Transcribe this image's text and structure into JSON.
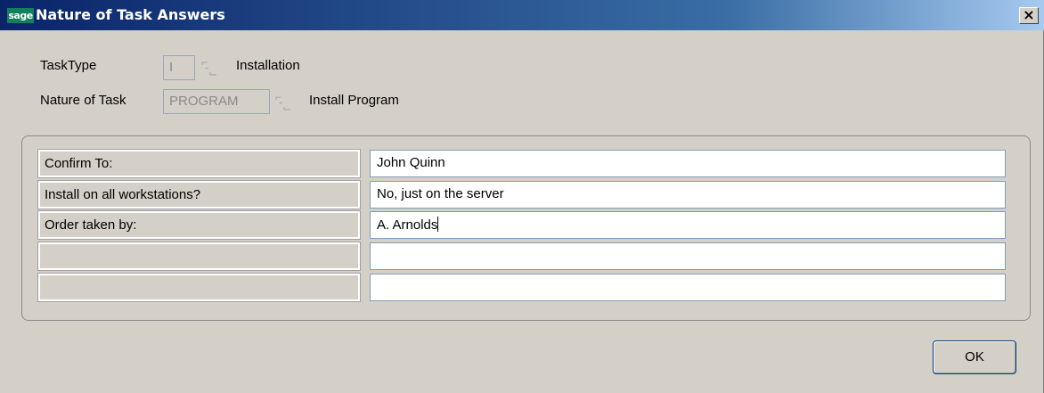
{
  "window": {
    "logo_text": "sage",
    "title": "Nature of Task Answers",
    "close_label": "×"
  },
  "form": {
    "task_type": {
      "label": "TaskType",
      "code": "I",
      "description": "Installation"
    },
    "nature_of_task": {
      "label": "Nature of Task",
      "code": "PROGRAM",
      "description": "Install Program"
    }
  },
  "answers": {
    "rows": [
      {
        "question": "Confirm To:",
        "answer": "John Quinn"
      },
      {
        "question": "Install on all workstations?",
        "answer": "No, just on the server"
      },
      {
        "question": "Order taken by:",
        "answer": "A. Arnolds"
      },
      {
        "question": "",
        "answer": ""
      },
      {
        "question": "",
        "answer": ""
      }
    ]
  },
  "buttons": {
    "ok_label": "OK"
  },
  "colors": {
    "title_gradient_start": "#0a246a",
    "title_gradient_end": "#a6caf0",
    "logo_green": "#12805c",
    "dialog_bg": "#d4d0c8"
  }
}
